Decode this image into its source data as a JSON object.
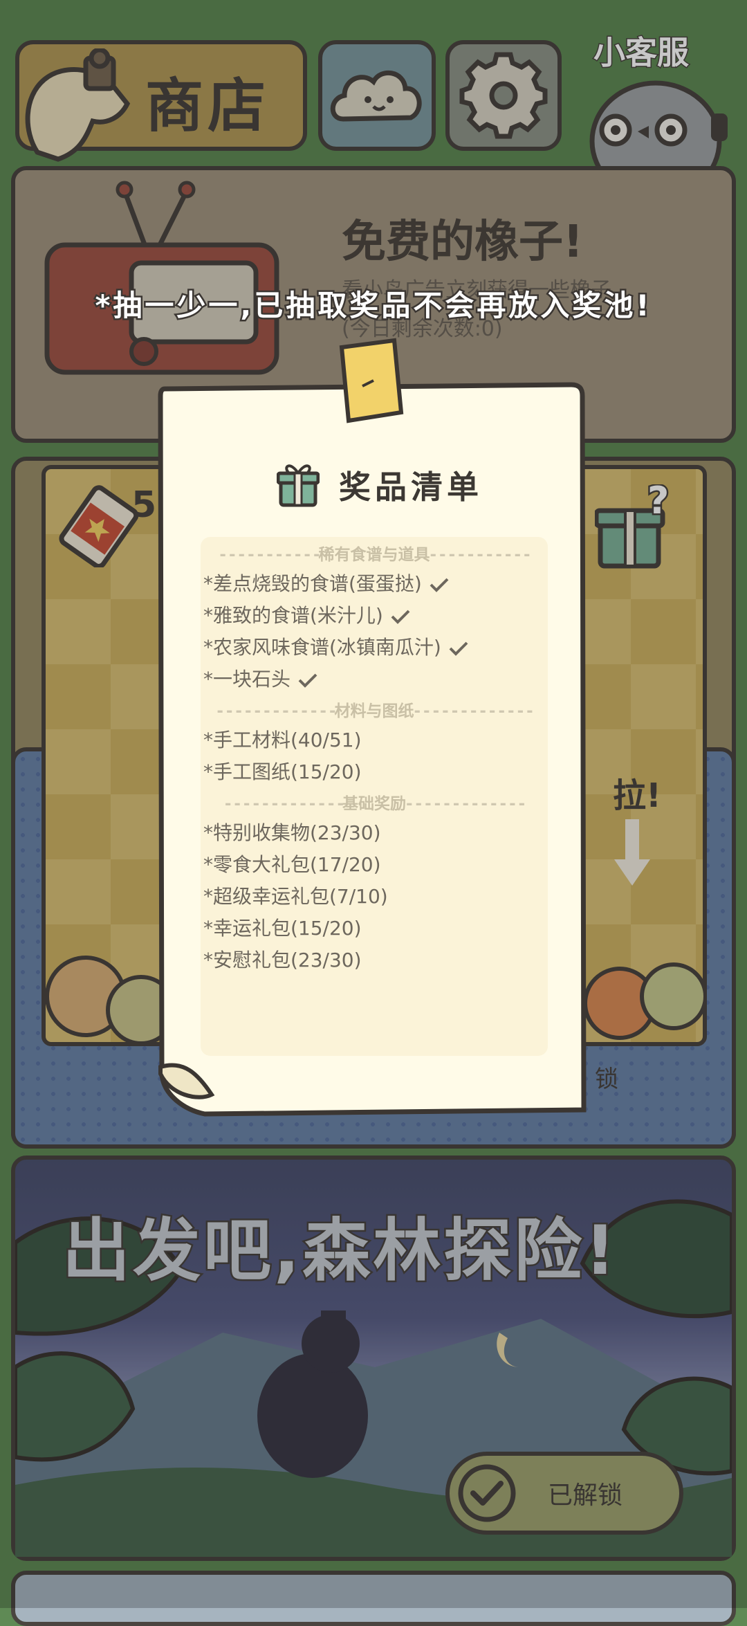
{
  "topbar": {
    "shop_label": "商店",
    "service_label": "小客服"
  },
  "free_acorns": {
    "title": "免费的橡子!",
    "desc": "看小鸟广告立刻获得一些橡子",
    "count": "(今日剩余次数:0)"
  },
  "gacha": {
    "ticket_count": "5",
    "pull_label": "拉!",
    "lock_label": "锁"
  },
  "forest": {
    "title": "出发吧,森林探险!",
    "unlocked_label": "已解锁"
  },
  "notice": "*抽一少一,已抽取奖品不会再放入奖池!",
  "prize_list": {
    "title": "奖品清单",
    "sections": [
      {
        "heading": "稀有食谱与道具",
        "items": [
          {
            "text": "*差点烧毁的食谱(蛋蛋挞)",
            "obtained": true
          },
          {
            "text": "*雅致的食谱(米汁儿)",
            "obtained": true
          },
          {
            "text": "*农家风味食谱(冰镇南瓜汁)",
            "obtained": true
          },
          {
            "text": "*一块石头",
            "obtained": true
          }
        ]
      },
      {
        "heading": "材料与图纸",
        "items": [
          {
            "text": "*手工材料(40/51)",
            "obtained": false
          },
          {
            "text": "*手工图纸(15/20)",
            "obtained": false
          }
        ]
      },
      {
        "heading": "基础奖励",
        "items": [
          {
            "text": "*特别收集物(23/30)",
            "obtained": false
          },
          {
            "text": "*零食大礼包(17/20)",
            "obtained": false
          },
          {
            "text": "*超级幸运礼包(7/10)",
            "obtained": false
          },
          {
            "text": "*幸运礼包(15/20)",
            "obtained": false
          },
          {
            "text": "*安慰礼包(23/30)",
            "obtained": false
          }
        ]
      }
    ]
  },
  "colors": {
    "background": "#5f8a55",
    "outline": "#4a4540",
    "sheet": "#fffbe8",
    "list_box": "#fbf3d8",
    "tape": "#f2d26a"
  },
  "icons": [
    "shop-icon",
    "cloud-icon",
    "gear-icon",
    "service-bird-icon",
    "tv-icon",
    "ticket-icon",
    "mystery-gift-icon",
    "arrow-down-icon",
    "gift-icon",
    "check-icon",
    "tape-icon"
  ]
}
